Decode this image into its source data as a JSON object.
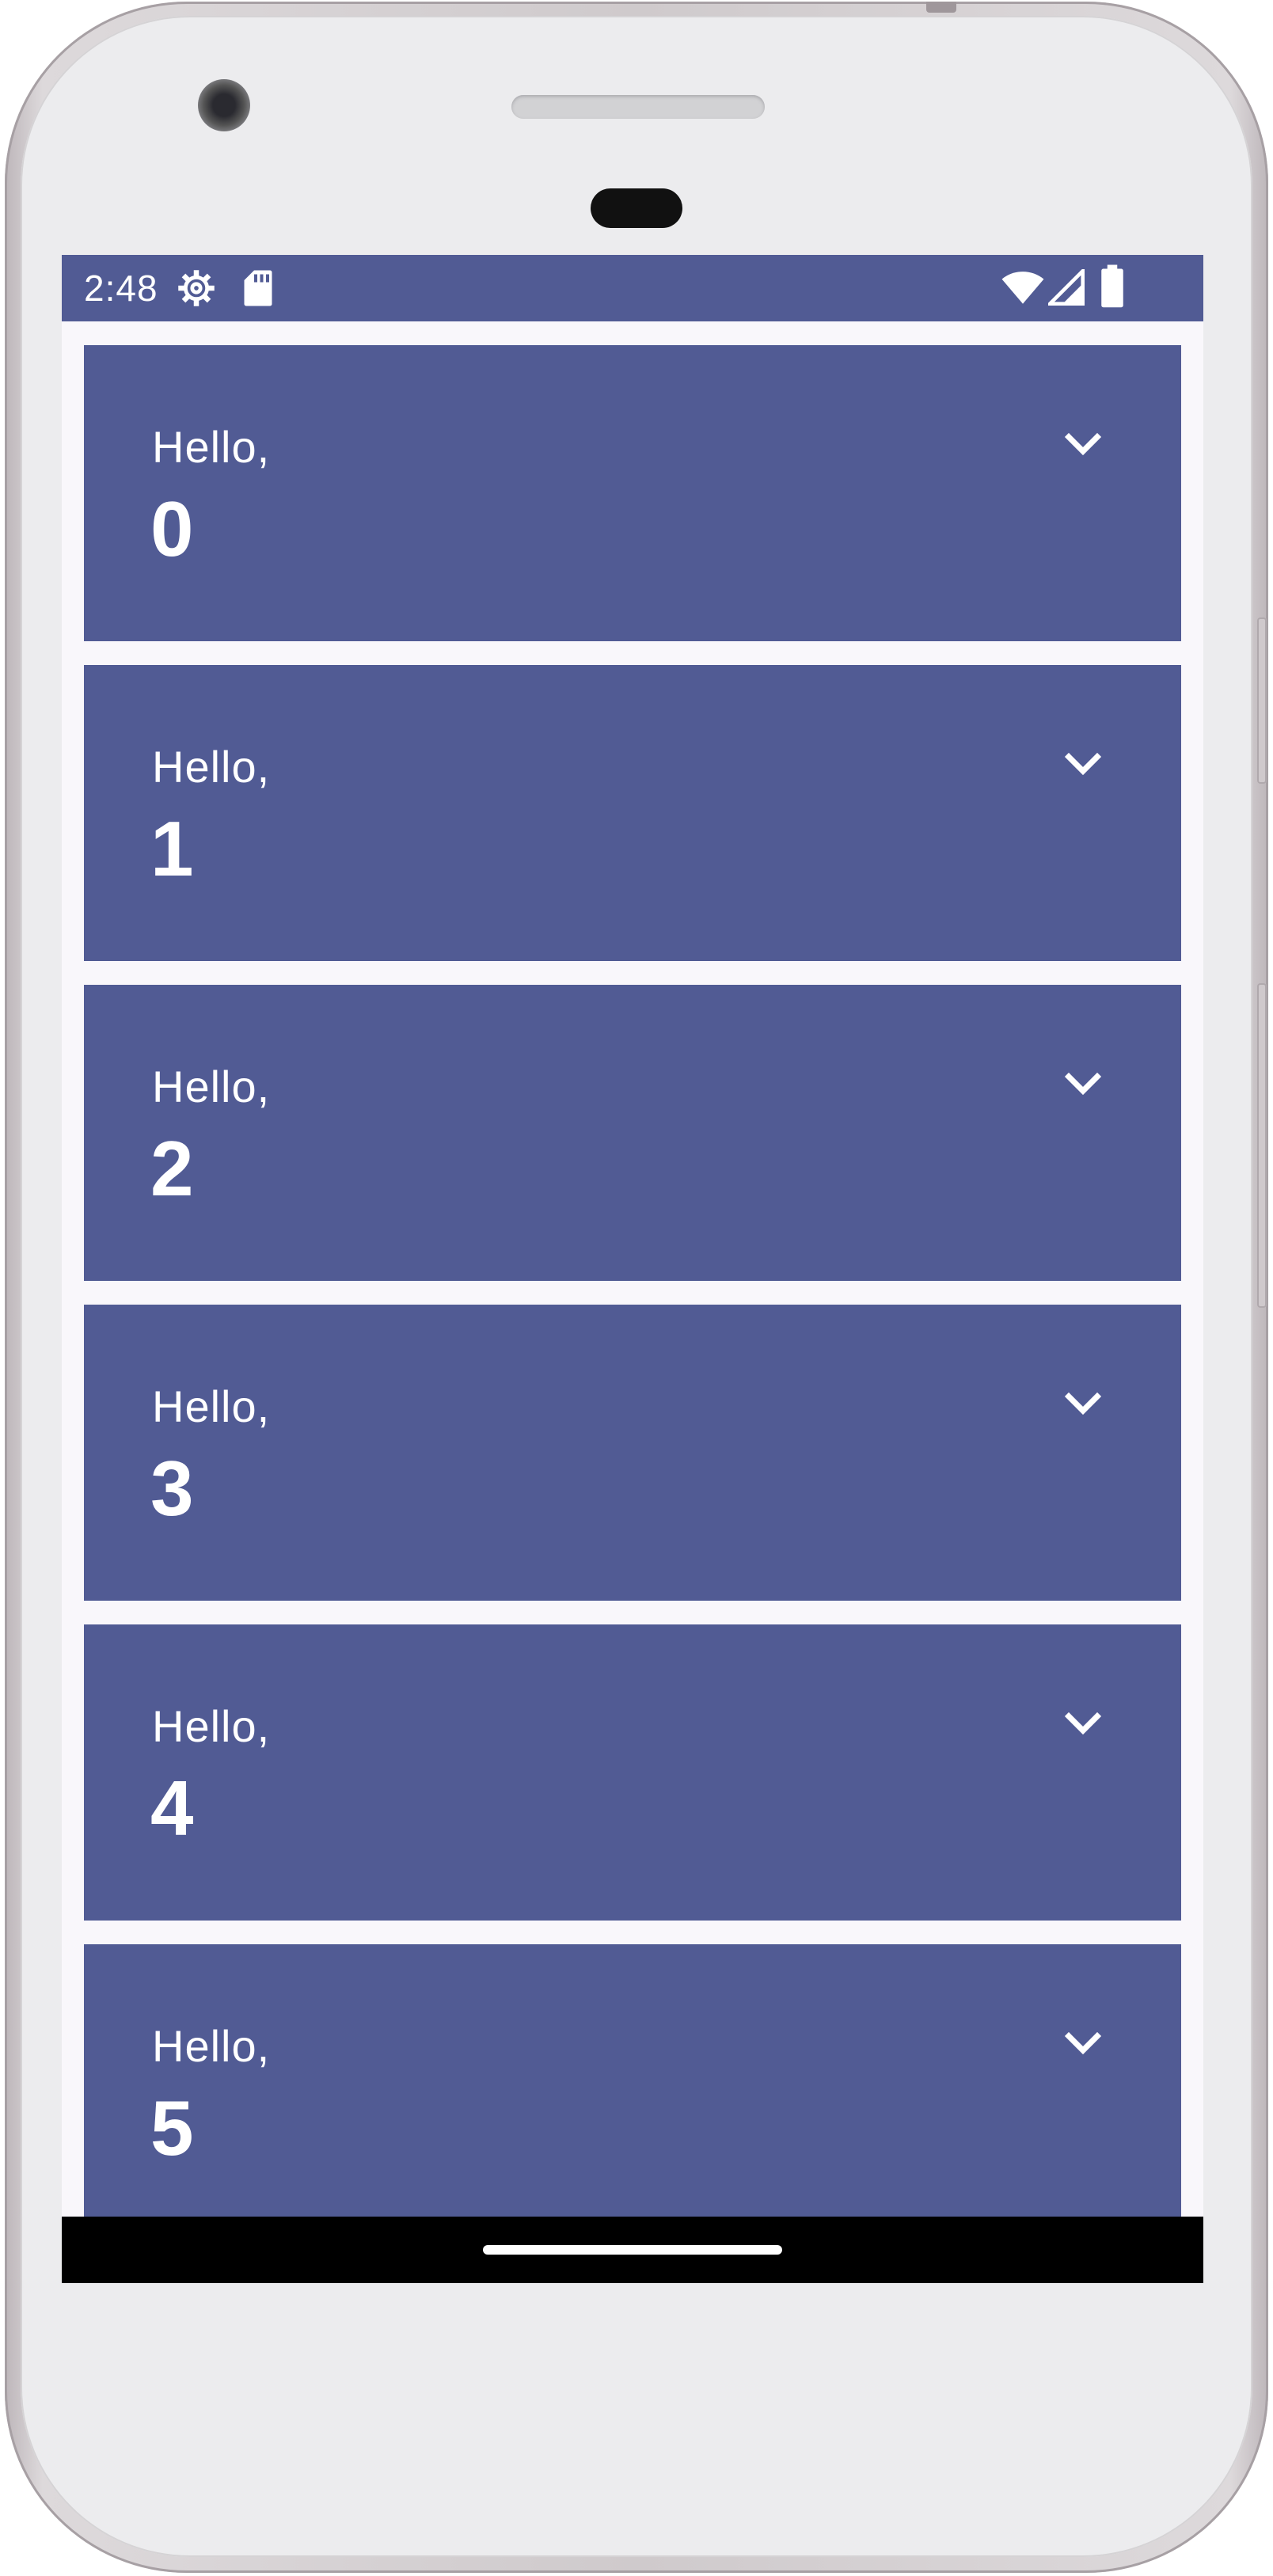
{
  "colors": {
    "accent": "#515b94",
    "background": "#f9f7fb",
    "on_accent": "#ffffff",
    "nav_bar": "#000000"
  },
  "status_bar": {
    "time": "2:48",
    "left_icons": [
      "settings-gear-icon",
      "sd-card-icon"
    ],
    "right_icons": [
      "wifi-icon",
      "cell-signal-icon",
      "battery-icon"
    ]
  },
  "cards": [
    {
      "greeting": "Hello,",
      "number": "0",
      "icon": "chevron-down-icon"
    },
    {
      "greeting": "Hello,",
      "number": "1",
      "icon": "chevron-down-icon"
    },
    {
      "greeting": "Hello,",
      "number": "2",
      "icon": "chevron-down-icon"
    },
    {
      "greeting": "Hello,",
      "number": "3",
      "icon": "chevron-down-icon"
    },
    {
      "greeting": "Hello,",
      "number": "4",
      "icon": "chevron-down-icon"
    },
    {
      "greeting": "Hello,",
      "number": "5",
      "icon": "chevron-down-icon"
    }
  ]
}
